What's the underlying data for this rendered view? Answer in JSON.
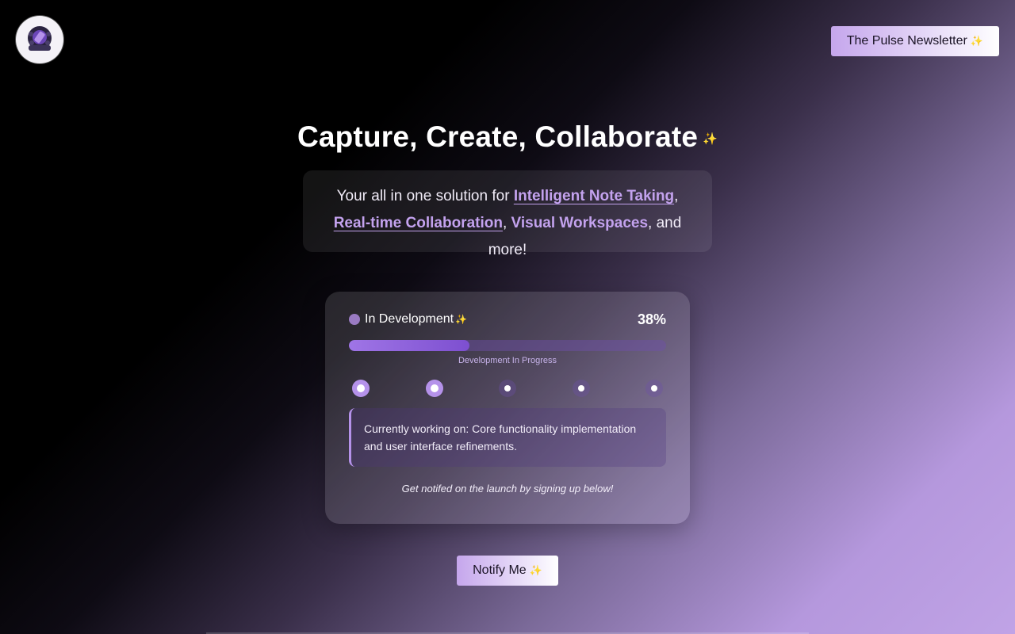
{
  "header": {
    "logo_icon": "app-logo",
    "newsletter_label": "The Pulse Newsletter",
    "newsletter_icon": "sparkle-icon"
  },
  "hero": {
    "title": "Capture, Create, Collaborate",
    "tagline_prefix": "Your all in one solution for ",
    "feature_1": "Intelligent Note Taking",
    "sep_1": ",",
    "feature_2": "Real-time Collaboration",
    "sep_2": ", ",
    "feature_3": "Visual Workspaces",
    "tagline_suffix": ", and more!"
  },
  "status_card": {
    "status_label": "In Development",
    "percent_label": "38%",
    "progress": 0.38,
    "progress_caption": "Development In Progress",
    "steps": [
      {
        "state": "active"
      },
      {
        "state": "active"
      },
      {
        "state": "pending"
      },
      {
        "state": "pending"
      },
      {
        "state": "pending"
      }
    ],
    "current_work": "Currently working on: Core functionality implementation and user interface refinements.",
    "signup_note": "Get notifed on the launch by signing up below!"
  },
  "cta": {
    "notify_label": "Notify Me"
  },
  "colors": {
    "accent": "#b592ea",
    "link": "#c3a2ee",
    "progress_fill": "#8a5ddb"
  }
}
